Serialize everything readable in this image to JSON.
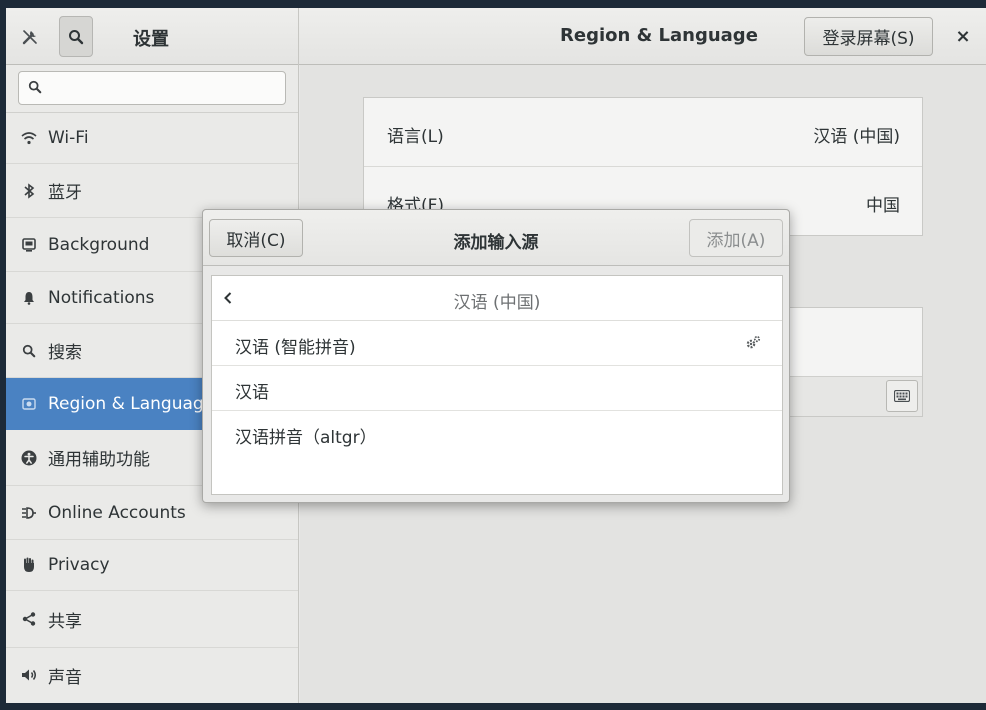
{
  "header": {
    "app_title": "设置",
    "panel_title": "Region & Language",
    "login_screen_button": "登录屏幕(S)",
    "close_glyph": "×"
  },
  "sidebar": {
    "search_placeholder": "",
    "items": [
      {
        "label": "Wi-Fi",
        "icon": "wifi-icon"
      },
      {
        "label": "蓝牙",
        "icon": "bluetooth-icon"
      },
      {
        "label": "Background",
        "icon": "background-icon"
      },
      {
        "label": "Notifications",
        "icon": "bell-icon"
      },
      {
        "label": "搜索",
        "icon": "search-icon"
      },
      {
        "label": "Region & Language",
        "icon": "region-icon",
        "active": true
      },
      {
        "label": "通用辅助功能",
        "icon": "accessibility-icon"
      },
      {
        "label": "Online Accounts",
        "icon": "online-accounts-icon"
      },
      {
        "label": "Privacy",
        "icon": "hand-icon"
      },
      {
        "label": "共享",
        "icon": "share-icon"
      },
      {
        "label": "声音",
        "icon": "speaker-icon"
      }
    ]
  },
  "main": {
    "language_label": "语言(L)",
    "language_value": "汉语 (中国)",
    "format_label": "格式(F)",
    "format_value": "中国"
  },
  "dialog": {
    "title": "添加输入源",
    "cancel_label": "取消(C)",
    "add_label": "添加(A)",
    "list_header": "汉语 (中国)",
    "items": [
      {
        "label": "汉语 (智能拼音)",
        "has_settings": true
      },
      {
        "label": "汉语",
        "has_settings": false
      },
      {
        "label": "汉语拼音（altgr）",
        "has_settings": false
      }
    ]
  },
  "colors": {
    "accent": "#4a82c2",
    "desktop": "#1d2a38"
  }
}
